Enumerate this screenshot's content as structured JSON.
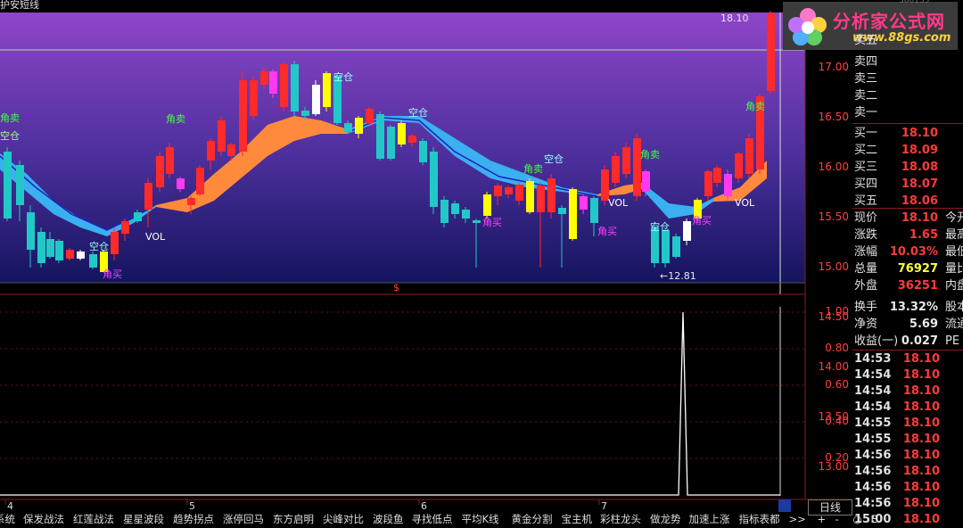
{
  "window": {
    "title": "护安短线"
  },
  "logo": {
    "brand": "分析家公式网",
    "url": "www.88gs.com",
    "top_code": "300155"
  },
  "main_chart": {
    "price_last_label": "18.10",
    "price_low_label": "12.81",
    "marker_dollar": "$",
    "annotations": [
      "空仓",
      "角卖",
      "角买",
      "VOL",
      "空仓",
      "角买",
      "角卖",
      "空仓",
      "空仓",
      "角卖",
      "角卖",
      "角买",
      "VOL",
      "空仓",
      "角买",
      "VOL",
      "角卖",
      "空仓"
    ],
    "price_axis": [
      "17.00",
      "16.50",
      "16.00",
      "15.50",
      "15.00",
      "14.50",
      "14.00",
      "13.50",
      "13.00"
    ],
    "colors": {
      "bg_top": "#8c44c8",
      "bg_bottom": "#1a1a6a",
      "up": "#ff2a2a",
      "down": "#22c8c8",
      "band_orange": "#ff8a3c",
      "band_blue": "#3ab0f0"
    }
  },
  "indicator_chart": {
    "axis": [
      "1.00",
      "0.80",
      "0.60",
      "0.40",
      "0.20"
    ],
    "chart_data": {
      "type": "line",
      "yrange": [
        0,
        1
      ],
      "series": [
        {
          "values": [
            0,
            0,
            0,
            0,
            0,
            0,
            0,
            0,
            0,
            0,
            0,
            0,
            1,
            0,
            0,
            0
          ]
        }
      ]
    }
  },
  "date_axis": [
    "4",
    "5",
    "6",
    "7"
  ],
  "period_button": "日线",
  "orderbook": {
    "sells": [
      {
        "label": "卖四",
        "price": ""
      },
      {
        "label": "卖三",
        "price": ""
      },
      {
        "label": "卖二",
        "price": ""
      },
      {
        "label": "卖一",
        "price": ""
      }
    ],
    "buys": [
      {
        "label": "买一",
        "price": "18.10"
      },
      {
        "label": "买二",
        "price": "18.09"
      },
      {
        "label": "买三",
        "price": "18.08"
      },
      {
        "label": "买四",
        "price": "18.07"
      },
      {
        "label": "买五",
        "price": "18.06"
      }
    ],
    "sell_top_partial": "卖五"
  },
  "quote": [
    {
      "label": "现价",
      "value": "18.10",
      "ext": "今开"
    },
    {
      "label": "涨跌",
      "value": "1.65",
      "ext": "最高"
    },
    {
      "label": "涨幅",
      "value": "10.03%",
      "ext": "最低"
    },
    {
      "label": "总量",
      "value": "76927",
      "ext": "量比"
    },
    {
      "label": "外盘",
      "value": "36251",
      "ext": "内盘"
    },
    {
      "label": "换手",
      "value": "13.32%",
      "ext": "股本"
    },
    {
      "label": "净资",
      "value": "5.69",
      "ext": "流通"
    },
    {
      "label": "收益(一)",
      "value": "0.027",
      "ext": "PE"
    }
  ],
  "ticks": [
    {
      "time": "14:53",
      "price": "18.10"
    },
    {
      "time": "14:54",
      "price": "18.10"
    },
    {
      "time": "14:54",
      "price": "18.10"
    },
    {
      "time": "14:54",
      "price": "18.10"
    },
    {
      "time": "14:55",
      "price": "18.10"
    },
    {
      "time": "14:55",
      "price": "18.10"
    },
    {
      "time": "14:56",
      "price": "18.10"
    },
    {
      "time": "14:56",
      "price": "18.10"
    },
    {
      "time": "14:56",
      "price": "18.10"
    },
    {
      "time": "14:56",
      "price": "18.10"
    },
    {
      "time": "15:00",
      "price": "18.10"
    }
  ],
  "bottom_tabs": [
    "系统",
    "保发战法",
    "红莲战法",
    "星星波段",
    "趋势拐点",
    "涨停回马",
    "东方启明",
    "尖峰对比",
    "波段鱼",
    "寻找低点",
    "平均K线",
    "黄金分割",
    "宝主机",
    "彩柱龙头",
    "做龙势",
    "加速上涨",
    "指标表都",
    ">>",
    "+",
    "-",
    "○",
    "E"
  ]
}
